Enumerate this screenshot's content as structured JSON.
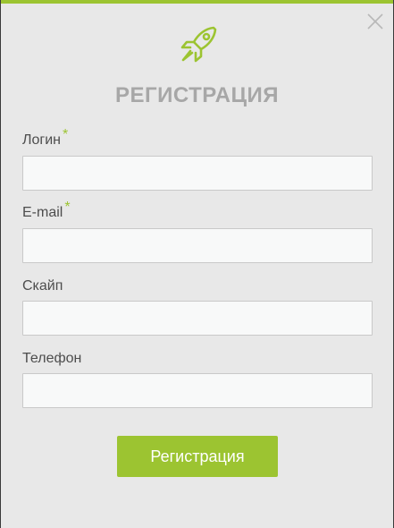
{
  "modal": {
    "title": "РЕГИСТРАЦИЯ",
    "accent_color": "#9cc431",
    "logo_icon": "rocket-icon",
    "close_icon": "close-icon"
  },
  "form": {
    "fields": [
      {
        "label": "Логин",
        "required_mark": "*",
        "value": ""
      },
      {
        "label": "E-mail",
        "required_mark": "*",
        "value": ""
      },
      {
        "label": "Скайп",
        "required_mark": "",
        "value": ""
      },
      {
        "label": "Телефон",
        "required_mark": "",
        "value": ""
      }
    ],
    "submit_label": "Регистрация"
  }
}
